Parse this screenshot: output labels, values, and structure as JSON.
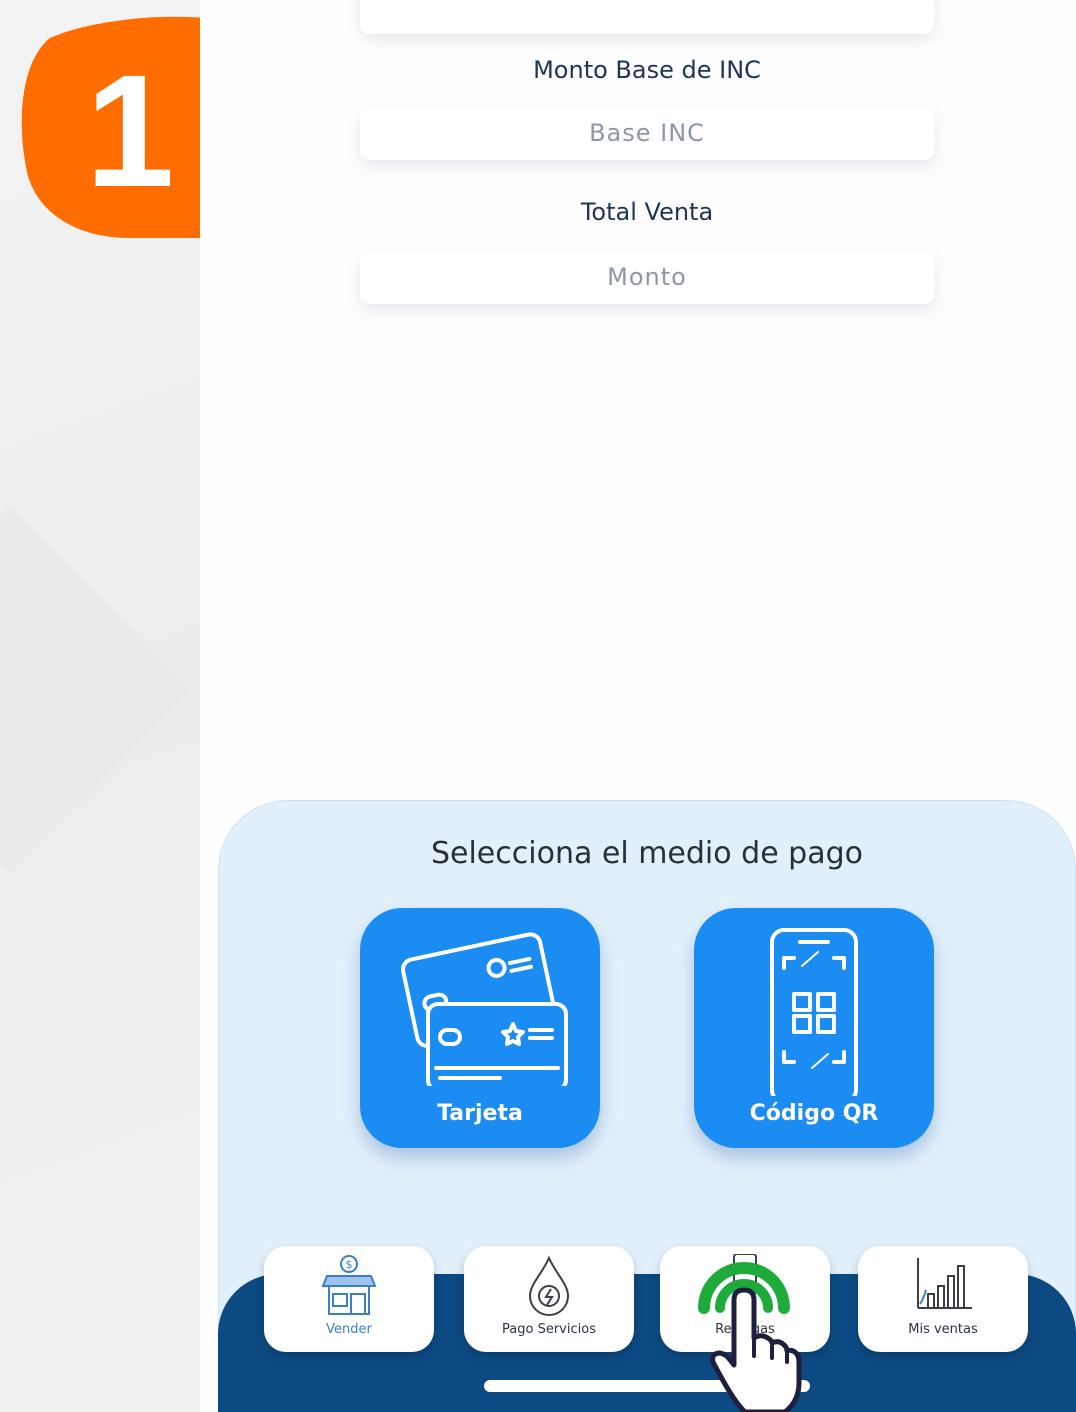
{
  "step": {
    "number": "1",
    "color": "#ff6d00"
  },
  "form": {
    "fields": [
      {
        "label": "Monto Base de INC",
        "placeholder": "Base INC"
      },
      {
        "label": "Total Venta",
        "placeholder": "Monto"
      }
    ]
  },
  "payment": {
    "title": "Selecciona el medio de pago",
    "options": [
      {
        "label": "Tarjeta",
        "icon": "credit-cards-icon"
      },
      {
        "label": "Código QR",
        "icon": "phone-qr-icon"
      }
    ]
  },
  "nav": {
    "items": [
      {
        "label": "Vender",
        "icon": "store-icon"
      },
      {
        "label": "Pago Servicios",
        "icon": "service-drop-icon"
      },
      {
        "label": "Recargas",
        "icon": "phone-recharge-icon"
      },
      {
        "label": "Mis ventas",
        "icon": "sales-chart-icon"
      }
    ],
    "active_index": 2
  },
  "colors": {
    "accent": "#1a8cf2",
    "nav_bg": "#0d4a83",
    "panel_bg": "#e2f0fc",
    "tap_indicator": "#1faa3c"
  }
}
